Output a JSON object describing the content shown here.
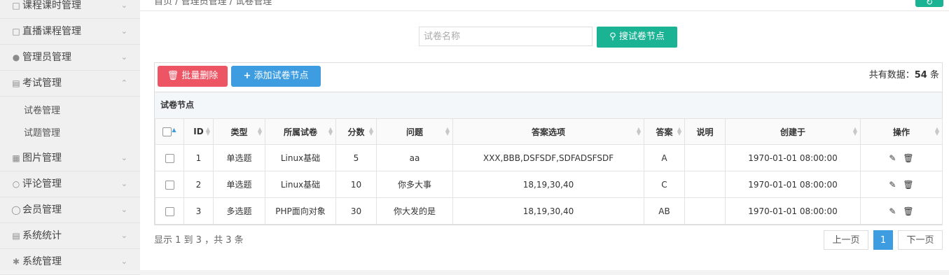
{
  "sidebar": {
    "items": [
      {
        "label": "课程课时管理",
        "icon": "bag-icon"
      },
      {
        "label": "直播课程管理",
        "icon": "bag-icon"
      },
      {
        "label": "管理员管理",
        "icon": "user-icon"
      },
      {
        "label": "考试管理",
        "icon": "chart-icon"
      },
      {
        "label": "图片管理",
        "icon": "image-icon"
      },
      {
        "label": "评论管理",
        "icon": "comment-icon"
      },
      {
        "label": "会员管理",
        "icon": "member-icon"
      },
      {
        "label": "系统统计",
        "icon": "chart-icon"
      },
      {
        "label": "系统管理",
        "icon": "gear-icon"
      }
    ],
    "sub_items": [
      "试卷管理",
      "试题管理"
    ]
  },
  "breadcrumb": "首页 / 管理员管理 / 试卷管理",
  "search": {
    "placeholder": "试卷名称",
    "button_label": "搜试卷节点"
  },
  "toolbar": {
    "delete_label": "批量删除",
    "add_label": "添加试卷节点"
  },
  "total": {
    "prefix": "共有数据：",
    "count": "54",
    "suffix": " 条"
  },
  "table": {
    "caption": "试卷节点",
    "headers": [
      "ID",
      "类型",
      "所属试卷",
      "分数",
      "问题",
      "答案选项",
      "答案",
      "说明",
      "创建于",
      "操作"
    ],
    "rows": [
      {
        "id": "1",
        "type": "单选题",
        "paper": "Linux基础",
        "score": "5",
        "question": "aa",
        "options": "XXX,BBB,DSFSDF,SDFADSFSDF",
        "answer": "A",
        "note": "",
        "created": "1970-01-01 08:00:00"
      },
      {
        "id": "2",
        "type": "单选题",
        "paper": "Linux基础",
        "score": "10",
        "question": "你多大事",
        "options": "18,19,30,40",
        "answer": "C",
        "note": "",
        "created": "1970-01-01 08:00:00"
      },
      {
        "id": "3",
        "type": "多选题",
        "paper": "PHP面向对象",
        "score": "30",
        "question": "你大发的是",
        "options": "18,19,30,40",
        "answer": "AB",
        "note": "",
        "created": "1970-01-01 08:00:00"
      }
    ]
  },
  "footer": {
    "info": "显示 1 到 3 ，共 3 条",
    "prev": "上一页",
    "page": "1",
    "next": "下一页"
  },
  "colors": {
    "primary": "#1ab394",
    "danger": "#ed5565",
    "info": "#3e9de0"
  }
}
